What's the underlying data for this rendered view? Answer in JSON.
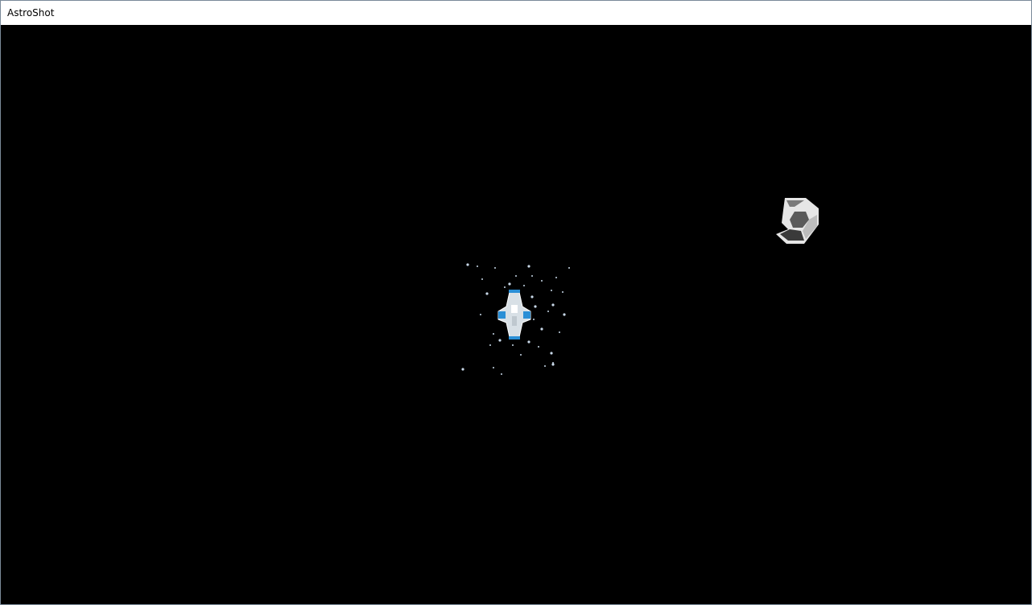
{
  "window": {
    "title": "AstroShot"
  },
  "game": {
    "background_color": "#000000",
    "player_ship": {
      "icon": "spaceship-icon",
      "hull_color": "#d8e0e6",
      "accent_color": "#2a8fd6"
    },
    "enemy": {
      "icon": "enemy-ship-icon",
      "colors": [
        "#e6e6e6",
        "#7a7a7a",
        "#3a3a3a"
      ]
    },
    "particles": {
      "icon": "exhaust-particles",
      "color": "#c8d8e8"
    }
  }
}
